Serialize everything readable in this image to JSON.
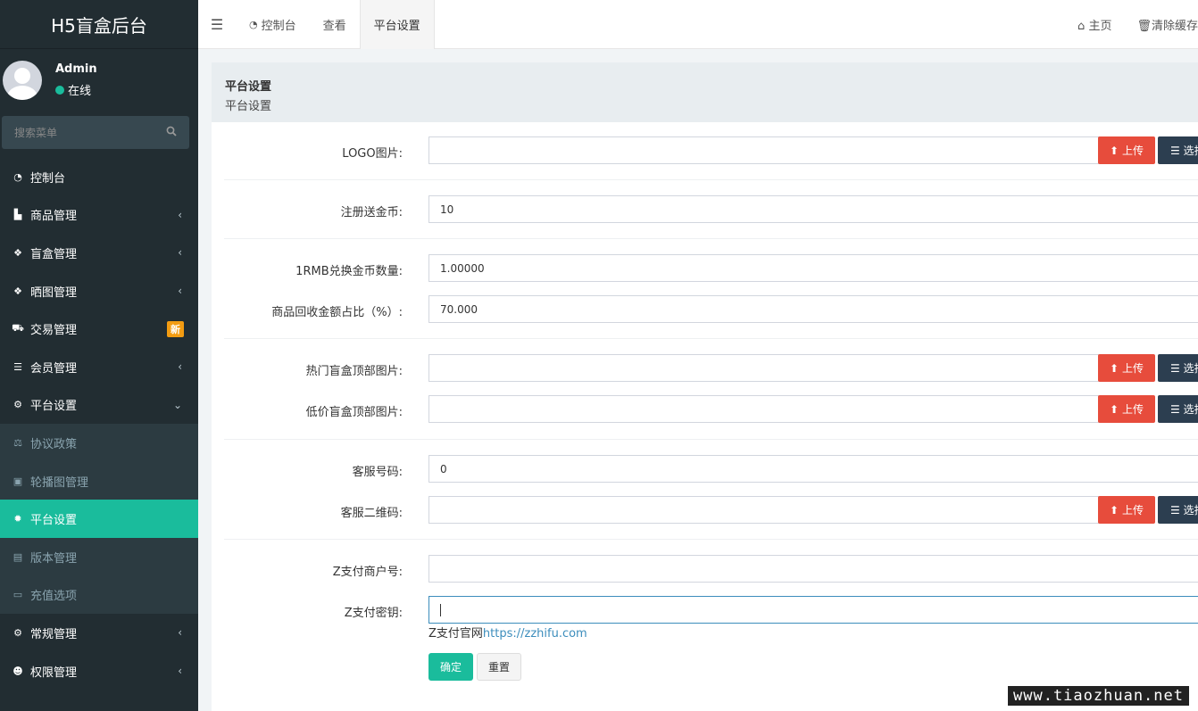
{
  "app": {
    "title": "H5盲盒后台"
  },
  "user": {
    "name": "Admin",
    "status": "在线"
  },
  "sidebar": {
    "search_placeholder": "搜索菜单",
    "items": [
      {
        "label": "控制台",
        "icon": "dashboard-icon"
      },
      {
        "label": "商品管理",
        "icon": "shopping-bag-icon"
      },
      {
        "label": "盲盒管理",
        "icon": "dropbox-icon"
      },
      {
        "label": "晒图管理",
        "icon": "dropbox-icon"
      },
      {
        "label": "交易管理",
        "icon": "cart-icon",
        "badge": "新"
      },
      {
        "label": "会员管理",
        "icon": "list-icon"
      },
      {
        "label": "平台设置",
        "icon": "cogs-icon"
      },
      {
        "label": "协议政策",
        "icon": "balance-scale-icon"
      },
      {
        "label": "轮播图管理",
        "icon": "image-icon"
      },
      {
        "label": "平台设置",
        "icon": "gear-icon"
      },
      {
        "label": "版本管理",
        "icon": "server-icon"
      },
      {
        "label": "充值选项",
        "icon": "credit-card-icon"
      },
      {
        "label": "常规管理",
        "icon": "cogs-icon"
      },
      {
        "label": "权限管理",
        "icon": "users-icon"
      }
    ]
  },
  "topbar": {
    "tabs": [
      {
        "label": "控制台"
      },
      {
        "label": "查看"
      },
      {
        "label": "平台设置"
      }
    ],
    "right": {
      "home": "主页",
      "clear": "清除缓存"
    }
  },
  "panel": {
    "title": "平台设置",
    "subtitle": "平台设置"
  },
  "form": {
    "upload_label": "上传",
    "choose_label": "选择",
    "fields": [
      {
        "label": "LOGO图片:",
        "value": ""
      },
      {
        "label": "注册送金币:",
        "value": "10"
      },
      {
        "label": "1RMB兑换金币数量:",
        "value": "1.00000"
      },
      {
        "label": "商品回收金额占比（%）:",
        "value": "70.000"
      },
      {
        "label": "热门盲盒顶部图片:",
        "value": ""
      },
      {
        "label": "低价盲盒顶部图片:",
        "value": ""
      },
      {
        "label": "客服号码:",
        "value": "0"
      },
      {
        "label": "客服二维码:",
        "value": ""
      },
      {
        "label": "Z支付商户号:",
        "value": ""
      },
      {
        "label": "Z支付密钥:",
        "value": ""
      }
    ],
    "help_prefix": "Z支付官网",
    "help_link": "https://zzhifu.com",
    "submit": "确定",
    "reset": "重置"
  },
  "watermark": "www.tiaozhuan.net"
}
